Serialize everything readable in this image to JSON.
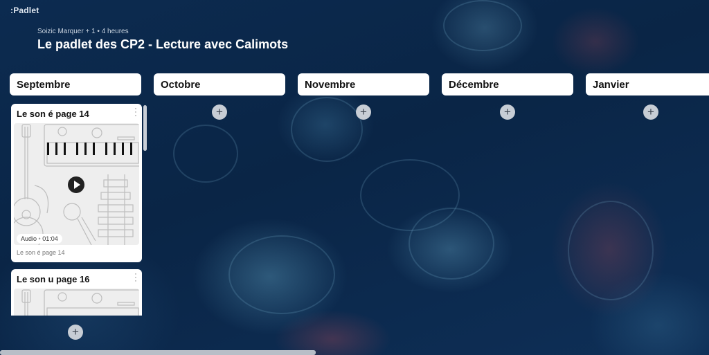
{
  "app": {
    "logo": ":Padlet"
  },
  "header": {
    "author": "Soizic Marquer + 1 • 4 heures",
    "title": "Le padlet des CP2 - Lecture avec Calimots"
  },
  "columns": [
    {
      "title": "Septembre"
    },
    {
      "title": "Octobre"
    },
    {
      "title": "Novembre"
    },
    {
      "title": "Décembre"
    },
    {
      "title": "Janvier"
    }
  ],
  "add_label": "+",
  "posts": [
    {
      "title": "Le son é page 14",
      "media_type": "Audio",
      "duration": "01:04",
      "caption": "Le son é page 14"
    },
    {
      "title": "Le son u page 16"
    }
  ],
  "badge_separator": "•",
  "colors": {
    "accent": "#0b2445",
    "card": "#ffffff",
    "add_button": "#c7cdd5"
  }
}
